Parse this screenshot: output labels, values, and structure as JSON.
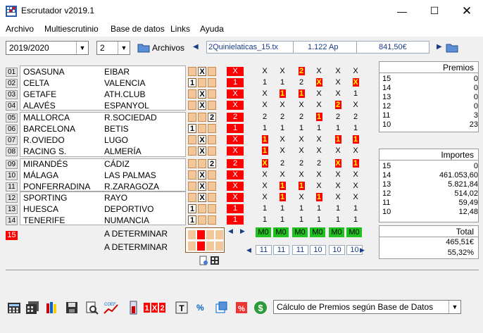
{
  "title": "Escrutador v2019.1",
  "menu": [
    "Archivo",
    "Multiescrutinio",
    "Base de datos",
    "Links",
    "Ayuda"
  ],
  "toolbar": {
    "season": "2019/2020",
    "number": "2",
    "archivos_label": "Archivos",
    "file": "2Quinielaticas_15.tx",
    "apuestas": "1.122 Ap",
    "importe": "841,50€"
  },
  "matches": [
    {
      "n": "01",
      "home": "OSASUNA",
      "away": "EIBAR",
      "pick": "X",
      "result": "X",
      "cols": [
        "X",
        "X",
        "2",
        "X",
        "X",
        "X"
      ],
      "marks": [
        false,
        false,
        true,
        false,
        false,
        false
      ]
    },
    {
      "n": "02",
      "home": "CELTA",
      "away": "VALENCIA",
      "pick": "1",
      "result": "1",
      "cols": [
        "1",
        "1",
        "2",
        "X",
        "X",
        "X"
      ],
      "marks": [
        false,
        false,
        false,
        true,
        false,
        true
      ]
    },
    {
      "n": "03",
      "home": "GETAFE",
      "away": "ATH.CLUB",
      "pick": "X",
      "result": "X",
      "cols": [
        "X",
        "1",
        "1",
        "X",
        "X",
        "1"
      ],
      "marks": [
        false,
        true,
        true,
        false,
        false,
        false
      ]
    },
    {
      "n": "04",
      "home": "ALAVÉS",
      "away": "ESPANYOL",
      "pick": "X",
      "result": "X",
      "cols": [
        "X",
        "X",
        "X",
        "X",
        "2",
        "X"
      ],
      "marks": [
        false,
        false,
        false,
        false,
        true,
        false
      ]
    },
    {
      "n": "05",
      "home": "MALLORCA",
      "away": "R.SOCIEDAD",
      "pick": "2",
      "result": "2",
      "cols": [
        "2",
        "2",
        "2",
        "1",
        "2",
        "2"
      ],
      "marks": [
        false,
        false,
        false,
        true,
        false,
        false
      ]
    },
    {
      "n": "06",
      "home": "BARCELONA",
      "away": "BETIS",
      "pick": "1",
      "result": "1",
      "cols": [
        "1",
        "1",
        "1",
        "1",
        "1",
        "1"
      ],
      "marks": [
        false,
        false,
        false,
        false,
        false,
        false
      ]
    },
    {
      "n": "07",
      "home": "R.OVIEDO",
      "away": "LUGO",
      "pick": "X",
      "result": "X",
      "cols": [
        "1",
        "X",
        "X",
        "X",
        "1",
        "1"
      ],
      "marks": [
        true,
        false,
        false,
        false,
        true,
        true
      ]
    },
    {
      "n": "08",
      "home": "RACING S.",
      "away": "ALMERÍA",
      "pick": "X",
      "result": "X",
      "cols": [
        "1",
        "X",
        "X",
        "X",
        "X",
        "X"
      ],
      "marks": [
        true,
        false,
        false,
        false,
        false,
        false
      ]
    },
    {
      "n": "09",
      "home": "MIRANDÉS",
      "away": "CÁDIZ",
      "pick": "2",
      "result": "2",
      "cols": [
        "X",
        "2",
        "2",
        "2",
        "X",
        "1"
      ],
      "marks": [
        true,
        false,
        false,
        false,
        true,
        true
      ]
    },
    {
      "n": "10",
      "home": "MÁLAGA",
      "away": "LAS PALMAS",
      "pick": "X",
      "result": "X",
      "cols": [
        "X",
        "X",
        "X",
        "X",
        "X",
        "X"
      ],
      "marks": [
        false,
        false,
        false,
        false,
        false,
        false
      ]
    },
    {
      "n": "11",
      "home": "PONFERRADINA",
      "away": "R.ZARAGOZA",
      "pick": "X",
      "result": "X",
      "cols": [
        "X",
        "1",
        "1",
        "X",
        "X",
        "X"
      ],
      "marks": [
        false,
        true,
        true,
        false,
        false,
        false
      ]
    },
    {
      "n": "12",
      "home": "SPORTING",
      "away": "RAYO",
      "pick": "X",
      "result": "X",
      "cols": [
        "X",
        "1",
        "X",
        "1",
        "X",
        "X"
      ],
      "marks": [
        false,
        true,
        false,
        true,
        false,
        false
      ]
    },
    {
      "n": "13",
      "home": "HUESCA",
      "away": "DEPORTIVO",
      "pick": "1",
      "result": "1",
      "cols": [
        "1",
        "1",
        "1",
        "1",
        "1",
        "1"
      ],
      "marks": [
        false,
        false,
        false,
        false,
        false,
        false
      ]
    },
    {
      "n": "14",
      "home": "TENERIFE",
      "away": "NUMANCIA",
      "pick": "1",
      "result": "1",
      "cols": [
        "1",
        "1",
        "1",
        "1",
        "1",
        "1"
      ],
      "marks": [
        false,
        false,
        false,
        false,
        false,
        false
      ]
    }
  ],
  "pleno": {
    "n": "15",
    "home": "A DETERMINAR",
    "away": "A DETERMINAR"
  },
  "m0_label": "M0",
  "counts": [
    "11",
    "11",
    "11",
    "10",
    "10",
    "10"
  ],
  "premios": {
    "title": "Premios",
    "rows": [
      [
        "15",
        "0"
      ],
      [
        "14",
        "0"
      ],
      [
        "13",
        "0"
      ],
      [
        "12",
        "0"
      ],
      [
        "11",
        "3"
      ],
      [
        "10",
        "23"
      ]
    ]
  },
  "importes": {
    "title": "Importes",
    "rows": [
      [
        "15",
        "0"
      ],
      [
        "14",
        "461.053,60"
      ],
      [
        "13",
        "5.821,84"
      ],
      [
        "12",
        "514,02"
      ],
      [
        "11",
        "59,49"
      ],
      [
        "10",
        "12,48"
      ]
    ]
  },
  "total": {
    "title": "Total",
    "amount": "465,51€",
    "percent": "55,32%"
  },
  "calc_select": "Cálculo de Premios según Base de Datos",
  "colors": {
    "red": "#ff0000",
    "green": "#21c021",
    "pick_bg": "#f4c79a",
    "blue": "#1a3c8a"
  }
}
